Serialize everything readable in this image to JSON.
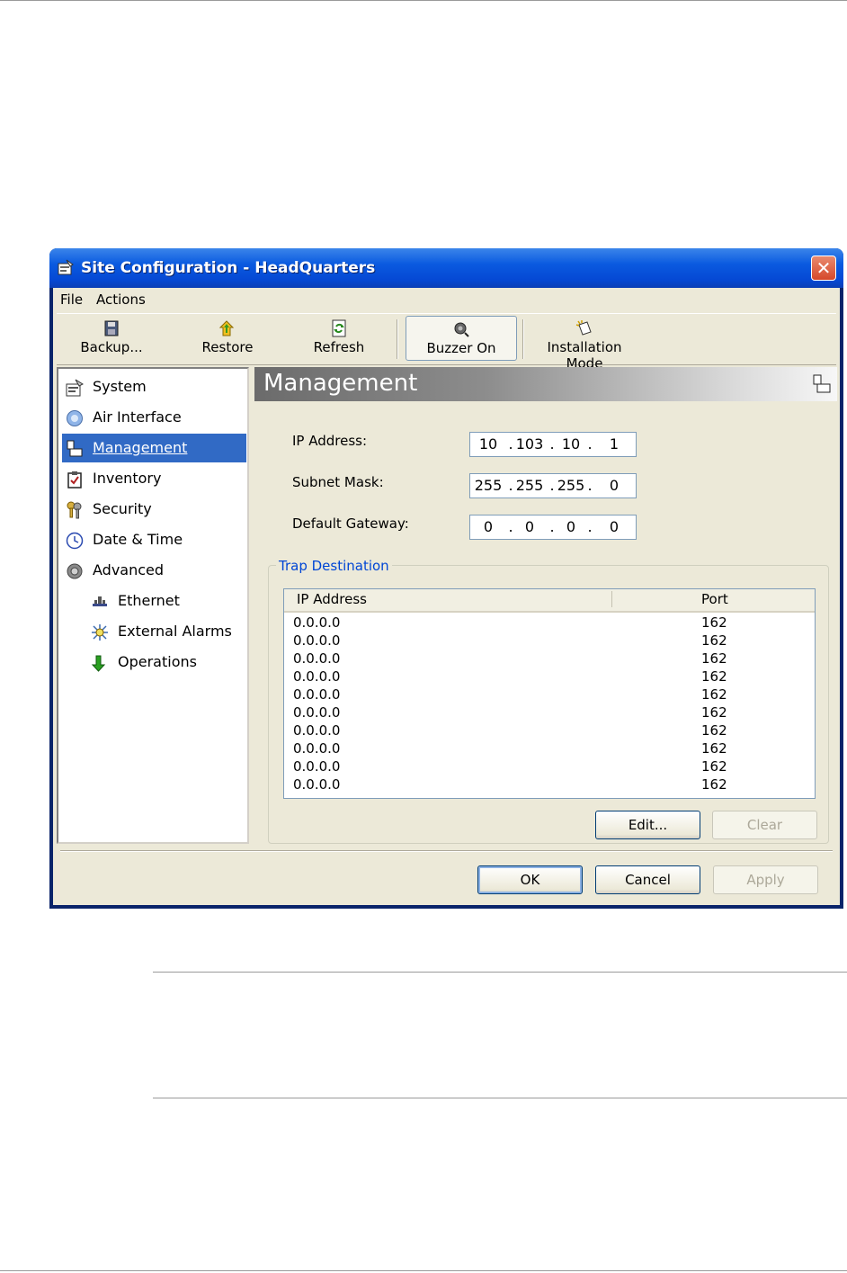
{
  "window": {
    "title": "Site Configuration - HeadQuarters",
    "close_glyph": "✕"
  },
  "menu": [
    "File",
    "Actions"
  ],
  "toolbar": {
    "backup": "Backup...",
    "restore": "Restore",
    "refresh": "Refresh",
    "buzzer": "Buzzer On",
    "install": "Installation Mode"
  },
  "tree": {
    "system": "System",
    "air": "Air Interface",
    "management": "Management",
    "inventory": "Inventory",
    "security": "Security",
    "datetime": "Date & Time",
    "advanced": "Advanced",
    "ethernet": "Ethernet",
    "alarms": "External Alarms",
    "operations": "Operations"
  },
  "panel": {
    "title": "Management",
    "ip_label": "IP Address:",
    "ip": [
      "10",
      "103",
      "10",
      "1"
    ],
    "subnet_label": "Subnet Mask:",
    "subnet": [
      "255",
      "255",
      "255",
      "0"
    ],
    "gateway_label": "Default Gateway:",
    "gateway": [
      "0",
      "0",
      "0",
      "0"
    ],
    "trap_legend": "Trap Destination",
    "col_ip": "IP Address",
    "col_port": "Port",
    "rows": [
      [
        "0.0.0.0",
        "162"
      ],
      [
        "0.0.0.0",
        "162"
      ],
      [
        "0.0.0.0",
        "162"
      ],
      [
        "0.0.0.0",
        "162"
      ],
      [
        "0.0.0.0",
        "162"
      ],
      [
        "0.0.0.0",
        "162"
      ],
      [
        "0.0.0.0",
        "162"
      ],
      [
        "0.0.0.0",
        "162"
      ],
      [
        "0.0.0.0",
        "162"
      ],
      [
        "0.0.0.0",
        "162"
      ]
    ],
    "edit": "Edit...",
    "clear": "Clear"
  },
  "footer": {
    "ok": "OK",
    "cancel": "Cancel",
    "apply": "Apply"
  },
  "ip_dot": "."
}
